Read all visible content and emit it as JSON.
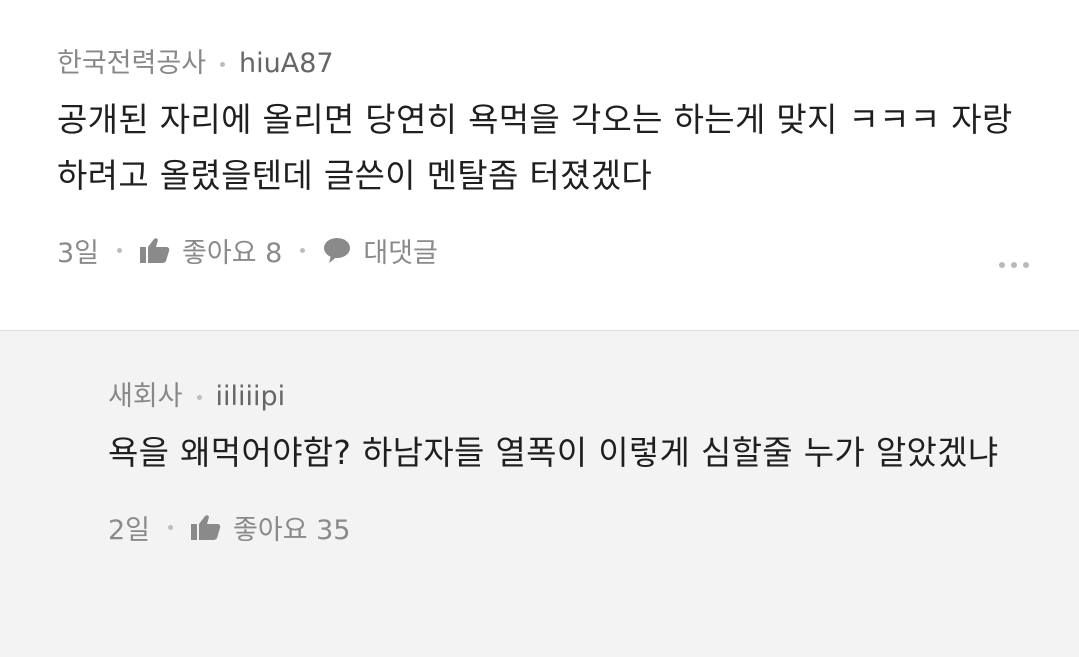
{
  "comments": [
    {
      "author": "한국전력공사",
      "username": "hiuA87",
      "text": "공개된 자리에 올리면 당연히 욕먹을 각오는 하는게 맞지 ㅋㅋㅋ 자랑하려고 올렸을텐데 글쓴이 멘탈좀 터졌겠다",
      "time": "3일",
      "likes_label": "좋아요 8",
      "reply_label": "대댓글"
    }
  ],
  "replies": [
    {
      "author": "새회사",
      "username": "iiliiipi",
      "text": "욕을 왜먹어야함? 하남자들 열폭이 이렇게 심할줄 누가 알았겠냐",
      "time": "2일",
      "likes_label": "좋아요 35"
    }
  ],
  "icons": {
    "like": "thumbs-up-icon",
    "reply": "speech-bubble-icon",
    "more": "more-dots-icon"
  }
}
